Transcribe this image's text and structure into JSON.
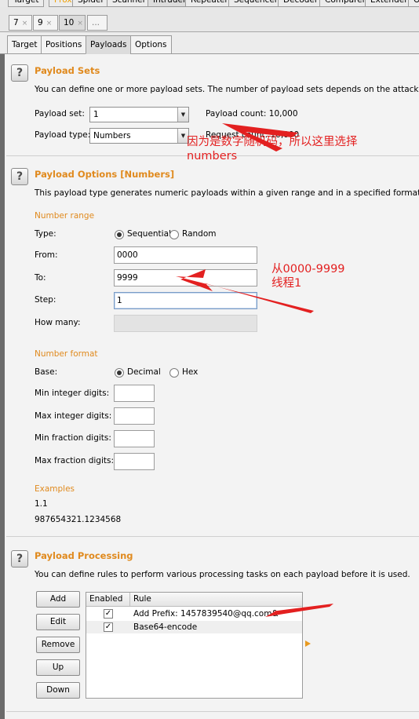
{
  "tool_tabs": [
    "Target",
    "Proxy",
    "Spider",
    "Scanner",
    "Intruder",
    "Repeater",
    "Sequencer",
    "Decoder",
    "Comparer",
    "Extender",
    "O"
  ],
  "attack_tabs": [
    {
      "label": "7",
      "close": "×"
    },
    {
      "label": "9",
      "close": "×"
    },
    {
      "label": "10",
      "close": "×"
    },
    {
      "label": "...",
      "close": ""
    }
  ],
  "sub_tabs": [
    "Target",
    "Positions",
    "Payloads",
    "Options"
  ],
  "payload_sets": {
    "title": "Payload Sets",
    "description": "You can define one or more payload sets. The number of payload sets depends on the attack type defined",
    "set_label": "Payload set:",
    "set_value": "1",
    "type_label": "Payload type:",
    "type_value": "Numbers",
    "payload_count": "Payload count:  10,000",
    "request_count": "Request count:  10,000"
  },
  "payload_options": {
    "title": "Payload Options [Numbers]",
    "description": "This payload type generates numeric payloads within a given range and in a specified format.",
    "number_range": "Number range",
    "type_label": "Type:",
    "sequential": "Sequential",
    "random": "Random",
    "from_label": "From:",
    "from_value": "0000",
    "to_label": "To:",
    "to_value": "9999",
    "step_label": "Step:",
    "step_value": "1",
    "how_many_label": "How many:",
    "number_format": "Number format",
    "base_label": "Base:",
    "decimal": "Decimal",
    "hex": "Hex",
    "min_int": "Min integer digits:",
    "max_int": "Max integer digits:",
    "min_frac": "Min fraction digits:",
    "max_frac": "Max fraction digits:",
    "examples": "Examples",
    "example1": "1.1",
    "example2": "987654321.1234568"
  },
  "payload_processing": {
    "title": "Payload Processing",
    "description": "You can define rules to perform various processing tasks on each payload before it is used.",
    "buttons": [
      "Add",
      "Edit",
      "Remove",
      "Up",
      "Down"
    ],
    "columns": [
      "Enabled",
      "Rule"
    ],
    "rules": [
      {
        "enabled": "✓",
        "rule": "Add Prefix: 1457839540@qq.com&"
      },
      {
        "enabled": "✓",
        "rule": "Base64-encode"
      }
    ]
  },
  "annotations": {
    "note1_line1": "因为是数字随机码，所以这里选择",
    "note1_line2": "numbers",
    "note2_line1": "从0000-9999",
    "note2_line2": "线程1"
  },
  "colors": {
    "section_title": "#e08a1e",
    "annotation": "#e32020"
  }
}
